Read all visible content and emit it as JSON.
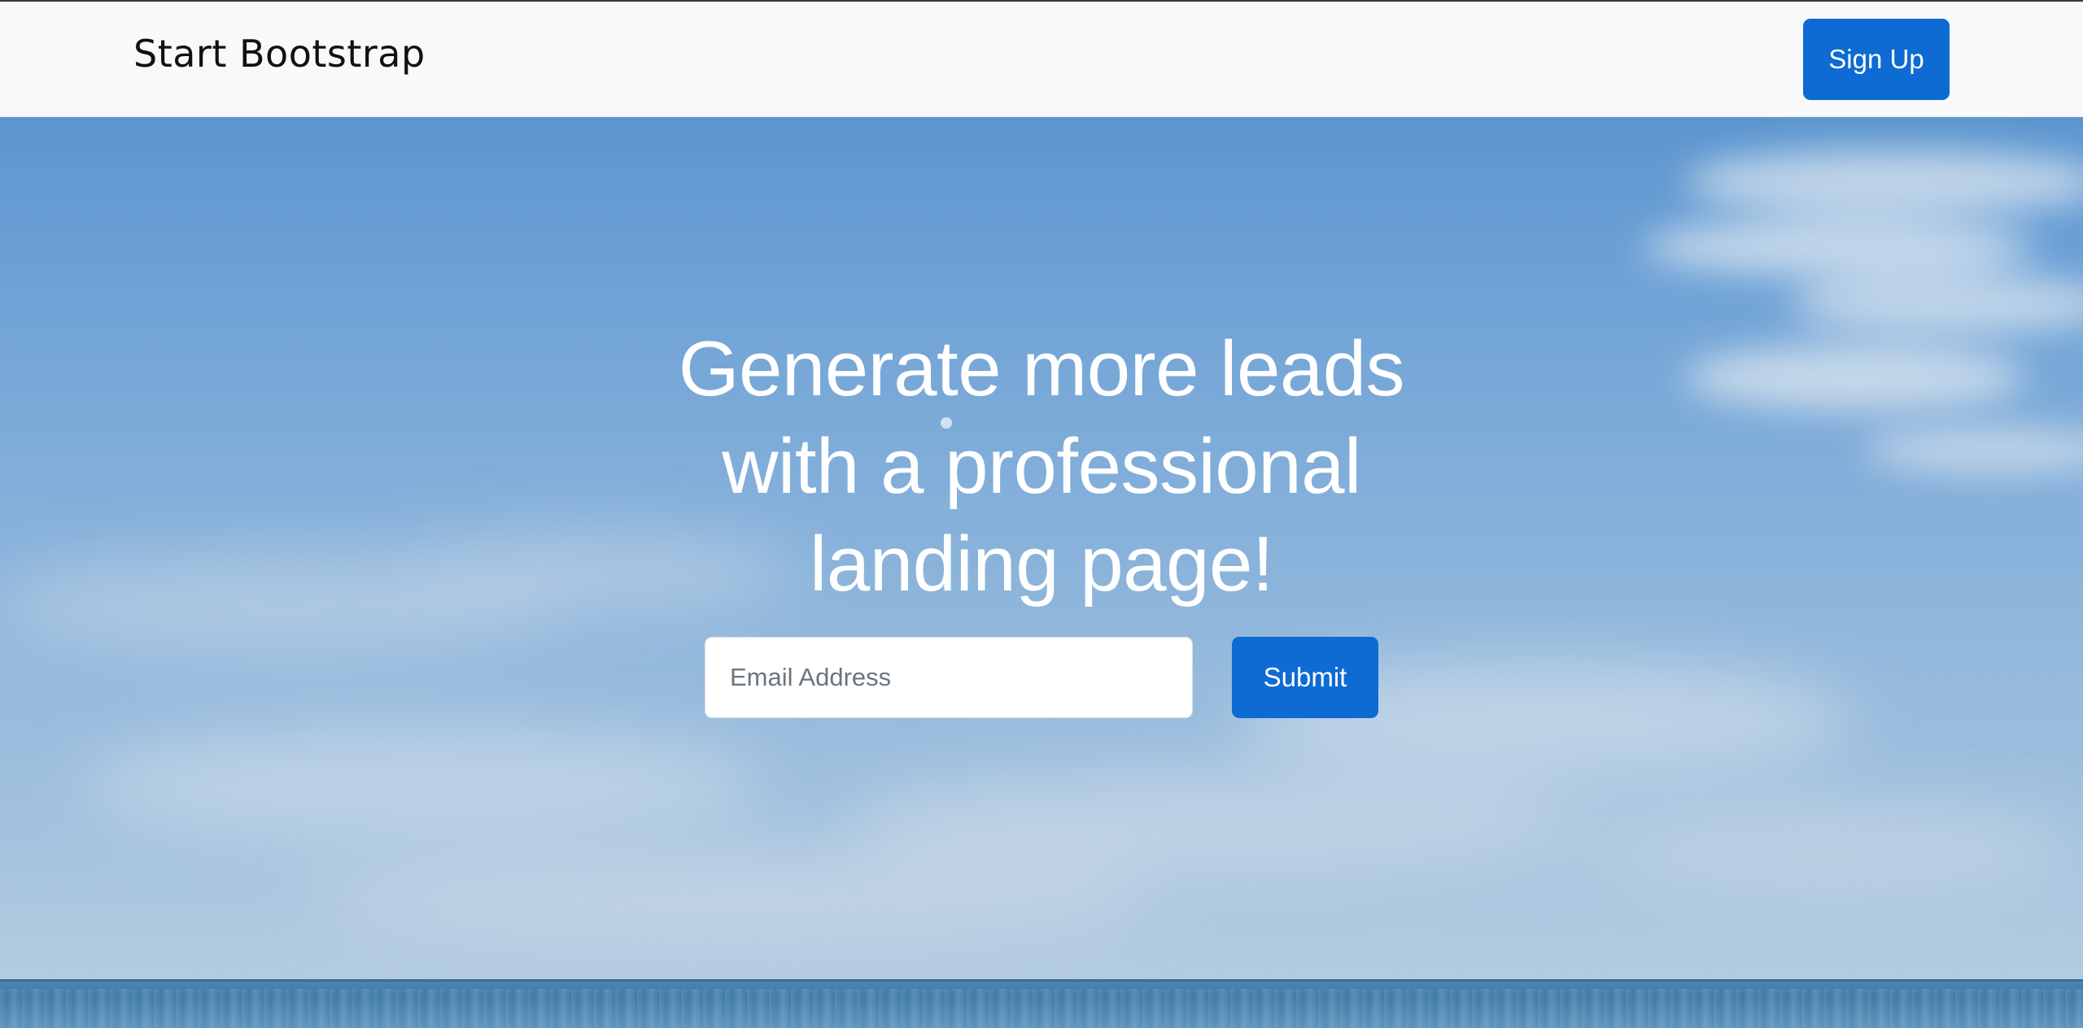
{
  "navbar": {
    "brand": "Start Bootstrap",
    "signup_label": "Sign Up"
  },
  "hero": {
    "headline_line1": "Generate more leads",
    "headline_line2": "with a professional",
    "headline_line3": "landing page!",
    "email_placeholder": "Email Address",
    "email_value": "",
    "submit_label": "Submit"
  },
  "colors": {
    "primary_button": "#0d6bd3",
    "navbar_bg": "#f8f9fa",
    "brand_text": "#111111",
    "hero_text": "#ffffff"
  }
}
